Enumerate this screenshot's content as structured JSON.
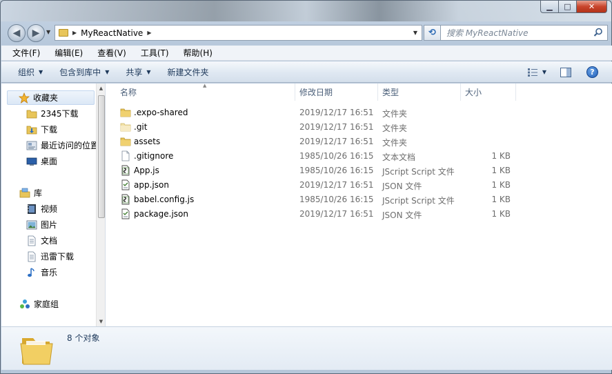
{
  "window": {
    "controls": {
      "minimize": "▁",
      "maximize": "□",
      "close": "✕"
    }
  },
  "address": {
    "path": "MyReactNative"
  },
  "search": {
    "placeholder": "搜索 MyReactNative"
  },
  "menu": [
    "文件(F)",
    "编辑(E)",
    "查看(V)",
    "工具(T)",
    "帮助(H)"
  ],
  "commands": [
    "组织",
    "包含到库中",
    "共享",
    "新建文件夹"
  ],
  "sidebar": {
    "favorites": {
      "label": "收藏夹",
      "items": [
        "2345下载",
        "下载",
        "最近访问的位置",
        "桌面"
      ]
    },
    "libraries": {
      "label": "库",
      "items": [
        "视频",
        "图片",
        "文档",
        "迅雷下载",
        "音乐"
      ]
    },
    "homegroup": {
      "label": "家庭组"
    }
  },
  "columns": [
    "名称",
    "修改日期",
    "类型",
    "大小"
  ],
  "files": [
    {
      "name": ".expo-shared",
      "date": "2019/12/17 16:51",
      "type": "文件夹",
      "size": "",
      "icon": "folder-icon"
    },
    {
      "name": ".git",
      "date": "2019/12/17 16:51",
      "type": "文件夹",
      "size": "",
      "icon": "folder-light-icon"
    },
    {
      "name": "assets",
      "date": "2019/12/17 16:51",
      "type": "文件夹",
      "size": "",
      "icon": "folder-icon"
    },
    {
      "name": ".gitignore",
      "date": "1985/10/26 16:15",
      "type": "文本文档",
      "size": "1 KB",
      "icon": "text-file-icon"
    },
    {
      "name": "App.js",
      "date": "1985/10/26 16:15",
      "type": "JScript Script 文件",
      "size": "1 KB",
      "icon": "script-file-icon"
    },
    {
      "name": "app.json",
      "date": "2019/12/17 16:51",
      "type": "JSON 文件",
      "size": "1 KB",
      "icon": "json-file-icon"
    },
    {
      "name": "babel.config.js",
      "date": "1985/10/26 16:15",
      "type": "JScript Script 文件",
      "size": "1 KB",
      "icon": "script-file-icon"
    },
    {
      "name": "package.json",
      "date": "2019/12/17 16:51",
      "type": "JSON 文件",
      "size": "1 KB",
      "icon": "json-file-icon"
    }
  ],
  "details": {
    "count": "8 个对象"
  }
}
